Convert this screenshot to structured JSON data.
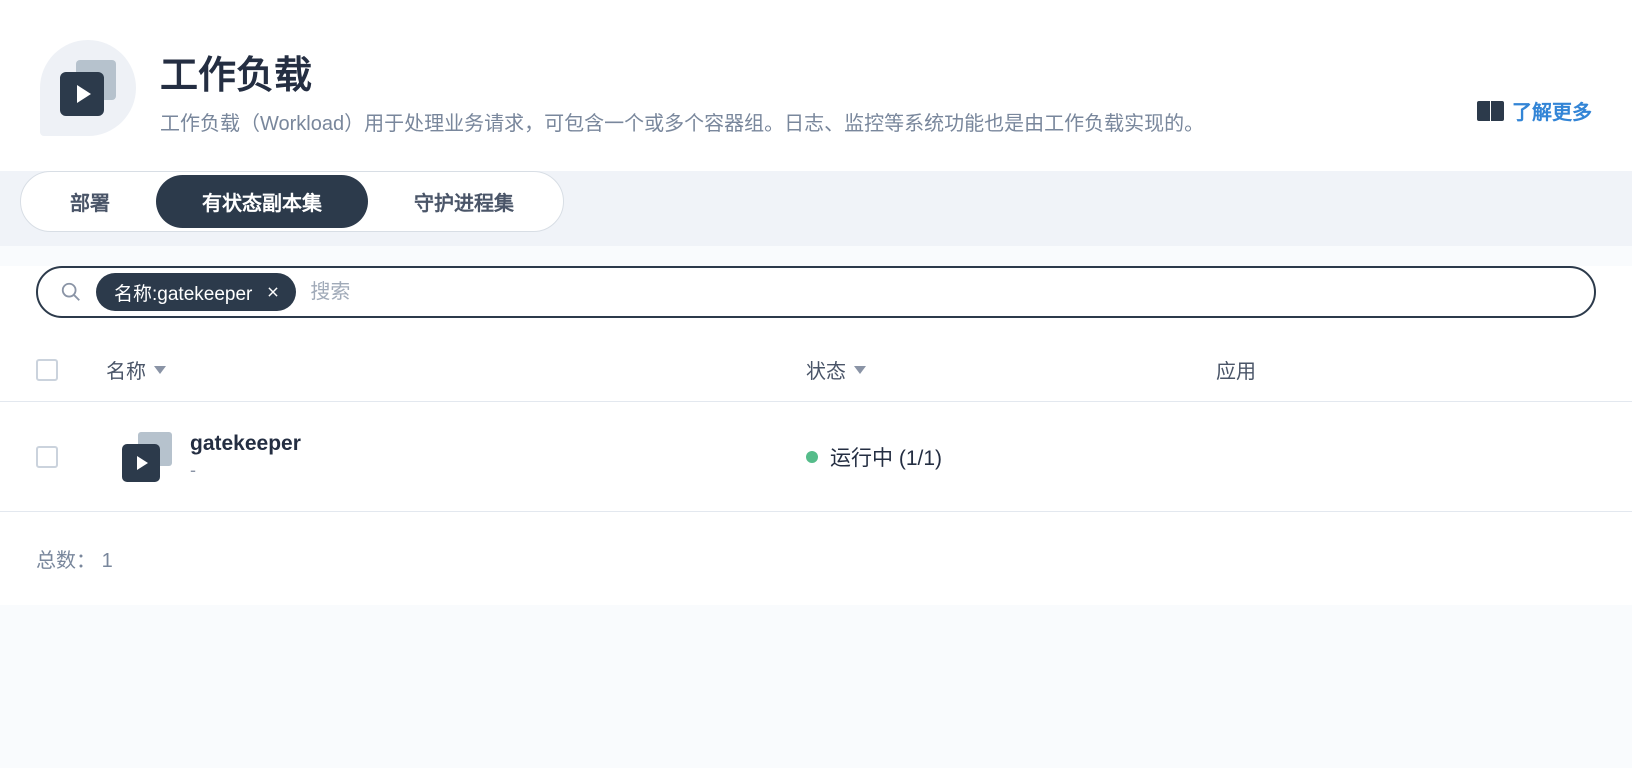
{
  "header": {
    "title": "工作负载",
    "description": "工作负载（Workload）用于处理业务请求，可包含一个或多个容器组。日志、监控等系统功能也是由工作负载实现的。",
    "learn_more": "了解更多"
  },
  "tabs": [
    {
      "label": "部署",
      "active": false
    },
    {
      "label": "有状态副本集",
      "active": true
    },
    {
      "label": "守护进程集",
      "active": false
    }
  ],
  "search": {
    "filter_chip": "名称:gatekeeper",
    "placeholder": "搜索"
  },
  "columns": {
    "name": "名称",
    "status": "状态",
    "app": "应用"
  },
  "rows": [
    {
      "name": "gatekeeper",
      "sub": "-",
      "status_text": "运行中 (1/1)",
      "status_color": "#55bc8a"
    }
  ],
  "footer": {
    "total_label": "总数：",
    "total_value": "1"
  }
}
